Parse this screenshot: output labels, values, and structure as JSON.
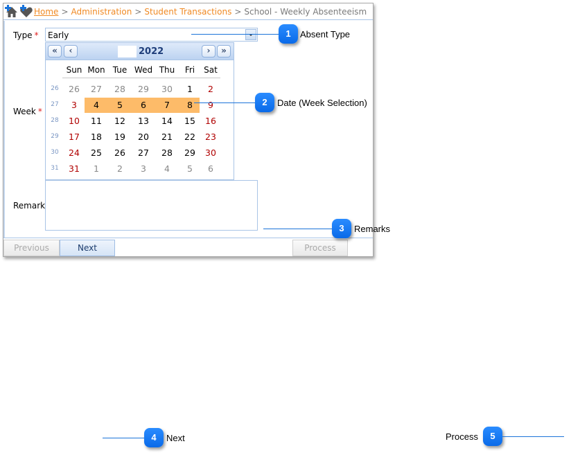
{
  "breadcrumb": {
    "items": [
      {
        "label": "Home",
        "link": true
      },
      {
        "label": "Administration",
        "link": true
      },
      {
        "label": "Student Transactions",
        "link": true
      },
      {
        "label": "School - Weekly Absenteeism",
        "link": false
      }
    ],
    "separator": ">"
  },
  "icons": {
    "home": "home-add-icon",
    "favorite": "favorite-add-icon"
  },
  "form": {
    "type_label": "Type",
    "week_label": "Week",
    "remarks_label": "Remarks",
    "required_marker": "*",
    "type_value": "Early",
    "remarks_value": ""
  },
  "calendar": {
    "nav": {
      "prev_year": "«",
      "prev_month": "‹",
      "next_month": "›",
      "next_year": "»"
    },
    "title": "2022",
    "days_of_week": [
      "Sun",
      "Mon",
      "Tue",
      "Wed",
      "Thu",
      "Fri",
      "Sat"
    ],
    "selected_week": 27,
    "selection_color": "#fdbb69",
    "weeks": [
      {
        "week": "26",
        "days": [
          {
            "d": "26",
            "other": true
          },
          {
            "d": "27",
            "other": true
          },
          {
            "d": "28",
            "other": true
          },
          {
            "d": "29",
            "other": true
          },
          {
            "d": "30",
            "other": true
          },
          {
            "d": "1",
            "other": false
          },
          {
            "d": "2",
            "other": false
          }
        ]
      },
      {
        "week": "27",
        "days": [
          {
            "d": "3",
            "other": false
          },
          {
            "d": "4",
            "other": false
          },
          {
            "d": "5",
            "other": false
          },
          {
            "d": "6",
            "other": false
          },
          {
            "d": "7",
            "other": false
          },
          {
            "d": "8",
            "other": false
          },
          {
            "d": "9",
            "other": false
          }
        ]
      },
      {
        "week": "28",
        "days": [
          {
            "d": "10",
            "other": false
          },
          {
            "d": "11",
            "other": false
          },
          {
            "d": "12",
            "other": false
          },
          {
            "d": "13",
            "other": false
          },
          {
            "d": "14",
            "other": false
          },
          {
            "d": "15",
            "other": false
          },
          {
            "d": "16",
            "other": false
          }
        ]
      },
      {
        "week": "29",
        "days": [
          {
            "d": "17",
            "other": false
          },
          {
            "d": "18",
            "other": false
          },
          {
            "d": "19",
            "other": false
          },
          {
            "d": "20",
            "other": false
          },
          {
            "d": "21",
            "other": false
          },
          {
            "d": "22",
            "other": false
          },
          {
            "d": "23",
            "other": false
          }
        ]
      },
      {
        "week": "30",
        "days": [
          {
            "d": "24",
            "other": false
          },
          {
            "d": "25",
            "other": false
          },
          {
            "d": "26",
            "other": false
          },
          {
            "d": "27",
            "other": false
          },
          {
            "d": "28",
            "other": false
          },
          {
            "d": "29",
            "other": false
          },
          {
            "d": "30",
            "other": false
          }
        ]
      },
      {
        "week": "31",
        "days": [
          {
            "d": "31",
            "other": false
          },
          {
            "d": "1",
            "other": true
          },
          {
            "d": "2",
            "other": true
          },
          {
            "d": "3",
            "other": true
          },
          {
            "d": "4",
            "other": true
          },
          {
            "d": "5",
            "other": true
          },
          {
            "d": "6",
            "other": true
          }
        ]
      }
    ]
  },
  "buttons": {
    "previous": "Previous",
    "next": "Next",
    "process": "Process"
  },
  "callouts": [
    {
      "number": "1",
      "label": "Absent Type"
    },
    {
      "number": "2",
      "label": "Date (Week Selection)"
    },
    {
      "number": "3",
      "label": "Remarks"
    },
    {
      "number": "4",
      "label": "Next"
    },
    {
      "number": "5",
      "label": "Process"
    }
  ],
  "colors": {
    "link": "#f08a24",
    "badge": "#0a6ae8",
    "weekend": "#b00000",
    "required": "#e02020"
  }
}
